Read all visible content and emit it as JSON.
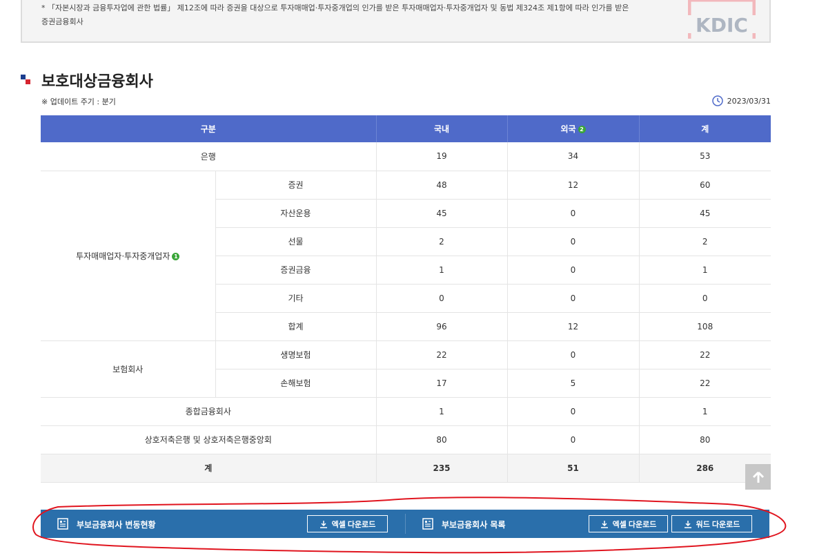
{
  "notice": {
    "line1": "* 「자본시장과 금융투자업에 관한 법률」 제12조에 따라 증권을 대상으로 투자매매업·투자중개업의 인가를 받은 투자매매업자·투자중개업자 및 동법 제324조 제1항에 따라 인가를 받은",
    "line2": "증권금융회사",
    "logo_text": "KDIC"
  },
  "section": {
    "title": "보호대상금융회사",
    "update_cycle": "※ 업데이트 주기 : 분기",
    "update_date": "2023/03/31"
  },
  "table": {
    "headers": {
      "category": "구분",
      "domestic": "국내",
      "foreign": "외국",
      "foreign_badge": "2",
      "total": "계"
    },
    "rows": {
      "bank": {
        "label": "은행",
        "domestic": "19",
        "foreign": "34",
        "total": "53"
      },
      "invest": {
        "label": "투자매매업자·투자중개업자",
        "badge": "1",
        "items": [
          {
            "label": "증권",
            "domestic": "48",
            "foreign": "12",
            "total": "60"
          },
          {
            "label": "자산운용",
            "domestic": "45",
            "foreign": "0",
            "total": "45"
          },
          {
            "label": "선물",
            "domestic": "2",
            "foreign": "0",
            "total": "2"
          },
          {
            "label": "증권금융",
            "domestic": "1",
            "foreign": "0",
            "total": "1"
          },
          {
            "label": "기타",
            "domestic": "0",
            "foreign": "0",
            "total": "0"
          },
          {
            "label": "합계",
            "domestic": "96",
            "foreign": "12",
            "total": "108"
          }
        ]
      },
      "insurance": {
        "label": "보험회사",
        "items": [
          {
            "label": "생명보험",
            "domestic": "22",
            "foreign": "0",
            "total": "22"
          },
          {
            "label": "손해보험",
            "domestic": "17",
            "foreign": "5",
            "total": "22"
          }
        ]
      },
      "general": {
        "label": "종합금융회사",
        "domestic": "1",
        "foreign": "0",
        "total": "1"
      },
      "savings": {
        "label": "상호저축은행 및 상호저축은행중앙회",
        "domestic": "80",
        "foreign": "0",
        "total": "80"
      },
      "sum": {
        "label": "계",
        "domestic": "235",
        "foreign": "51",
        "total": "286"
      }
    }
  },
  "downloads": {
    "left": {
      "label": "부보금융회사 변동현황",
      "excel": "엑셀 다운로드"
    },
    "right": {
      "label": "부보금융회사 목록",
      "excel": "엑셀 다운로드",
      "word": "워드 다운로드"
    }
  },
  "colors": {
    "header_bg": "#4f6ac9",
    "download_bar": "#2a6fab",
    "badge": "#3aa639",
    "annotation": "#e0141e"
  },
  "icons": [
    "kdic-logo",
    "clock-icon",
    "scroll-top-arrow-icon",
    "document-icon",
    "download-icon"
  ]
}
